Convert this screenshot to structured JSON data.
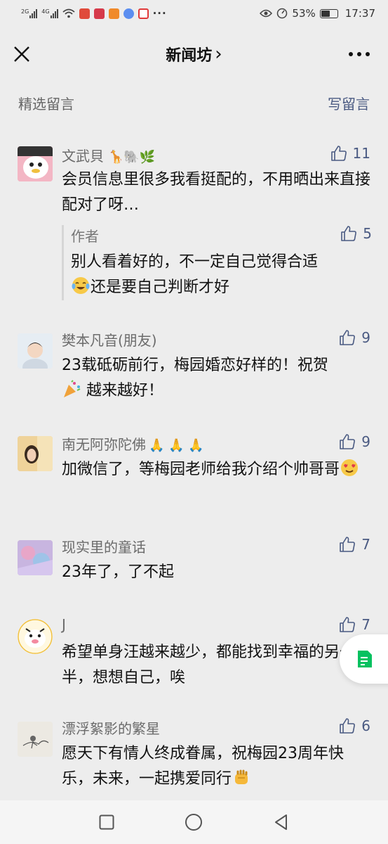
{
  "status_bar": {
    "sim1": "2G",
    "sim2": "4G",
    "more": "···",
    "battery": "53%",
    "battery_level": 0.53,
    "time": "17:37"
  },
  "nav": {
    "title": "新闻坊",
    "chevron": "›"
  },
  "section": {
    "title": "精选留言",
    "write": "写留言"
  },
  "comments": [
    {
      "name": "文武貝",
      "name_deco": "🦒🐘🌿",
      "likes": "11",
      "text": "会员信息里很多我看挺配的，不用晒出来直接配对了呀…",
      "reply": {
        "author": "作者",
        "likes": "5",
        "text_before": "别人看着好的，不一定自己觉得合适",
        "text_after": "还是要自己判断才好"
      }
    },
    {
      "name": "樊本凡音(朋友)",
      "likes": "9",
      "text_before": "23载砥砺前行，梅园婚恋好样的！祝贺",
      "text_after": "越来越好！"
    },
    {
      "name": "南无阿弥陀佛",
      "name_deco": "🙏 🙏 🙏",
      "likes": "9",
      "text": "加微信了，等梅园老师给我介绍个帅哥哥"
    },
    {
      "name": "现实里的童话",
      "likes": "7",
      "text": "23年了，了不起"
    },
    {
      "name": "J",
      "likes": "7",
      "text": "希望单身汪越来越少，都能找到幸福的另一半，想想自己，唉"
    },
    {
      "name": "漂浮絮影的繁星",
      "likes": "6",
      "text": "愿天下有情人终成眷属，祝梅园23周年快乐，未来，一起携爱同行"
    }
  ],
  "colors": {
    "background": "#ededed",
    "link": "#4a5a82",
    "name": "#6b6b6b",
    "accent_green": "#07c160"
  },
  "icons": {
    "close": "close-icon",
    "more": "more-icon",
    "like": "thumbs-up-icon",
    "float": "reading-list-icon",
    "recent": "square-icon",
    "home": "circle-icon",
    "back": "triangle-back-icon"
  }
}
